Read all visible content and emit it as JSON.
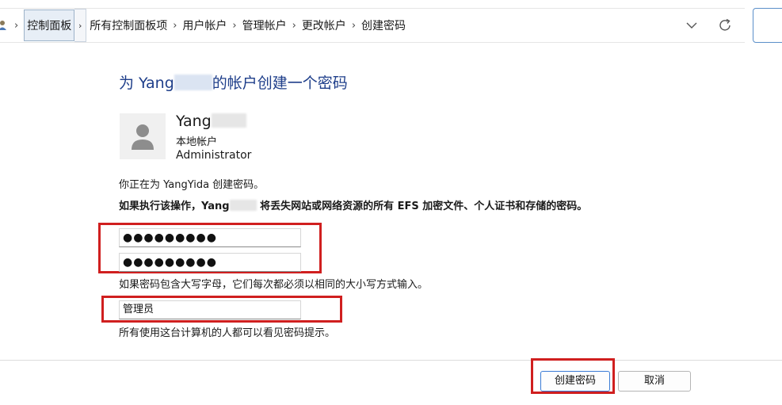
{
  "breadcrumb": {
    "items": [
      "控制面板",
      "所有控制面板项",
      "用户帐户",
      "管理帐户",
      "更改帐户",
      "创建密码"
    ]
  },
  "page": {
    "title_prefix": "为 Yang",
    "title_suffix": "的帐户创建一个密码"
  },
  "account": {
    "name": "Yang",
    "type": "本地帐户",
    "role": "Administrator"
  },
  "messages": {
    "creating": "你正在为 YangYida 创建密码。",
    "warning_prefix": "如果执行该操作，Yang",
    "warning_suffix": " 将丢失网站或网络资源的所有 EFS 加密文件、个人证书和存储的密码。",
    "case_note": "如果密码包含大写字母，它们每次都必须以相同的大小写方式输入。",
    "hint_note": "所有使用这台计算机的人都可以看见密码提示。"
  },
  "form": {
    "new_password": "●●●●●●●●●",
    "confirm_password": "●●●●●●●●●",
    "hint": "管理员"
  },
  "buttons": {
    "create": "创建密码",
    "cancel": "取消"
  },
  "colors": {
    "highlight": "#d01f1f",
    "title": "#1e3e8a"
  }
}
